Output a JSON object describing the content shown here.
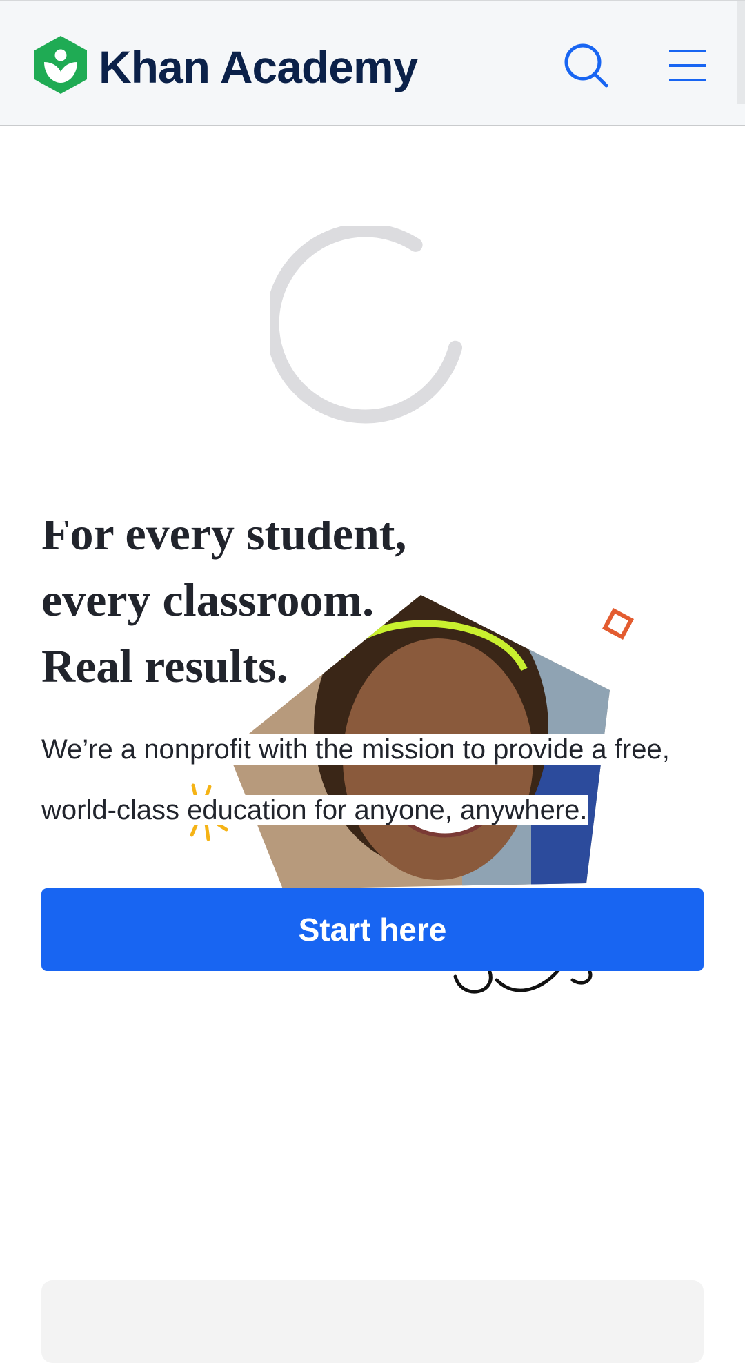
{
  "header": {
    "brand_name": "Khan Academy",
    "logo_icon": "khan-academy-leaf-hexagon-icon",
    "search_icon": "search-icon",
    "menu_icon": "hamburger-menu-icon"
  },
  "loading": {
    "indicator_icon": "loading-spinner-icon"
  },
  "hero": {
    "headline_lines": [
      "For every student,",
      "every classroom.",
      "Real results."
    ],
    "description_lines": [
      "We’re a nonprofit with the mission to provide a free,",
      "world-class education for anyone, anywhere."
    ],
    "cta_label": "Start here",
    "image": "student-smiling-photo"
  },
  "colors": {
    "brand_navy": "#0b2149",
    "brand_green": "#1fab54",
    "action_blue": "#1865f2",
    "text": "#21242c",
    "header_bg": "#f5f7f9",
    "spinner_gray": "#dcdcdf",
    "accent_orange": "#e35c30",
    "accent_yellow": "#f5b315"
  }
}
